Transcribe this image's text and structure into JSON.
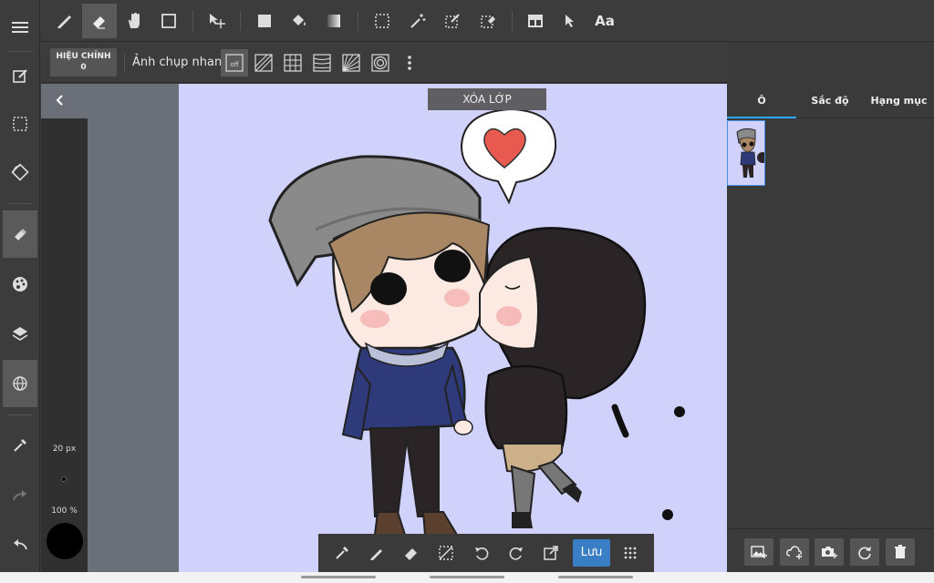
{
  "sub_toolbar": {
    "correction_line1": "HIỆU CHỈNH",
    "correction_line2": "0",
    "snapshot_label": "Ảnh chụp nhanh",
    "snapshot_off": "off"
  },
  "top_toolbar": {
    "text_tool": "Aa"
  },
  "canvas": {
    "clear_layer_label": "XÓA LỚP",
    "background_color": "#d1d2fb"
  },
  "brush_panel": {
    "size_label": "20 px",
    "opacity_label": "100 %",
    "color": "#000000"
  },
  "float_toolbar": {
    "save_label": "Lưu"
  },
  "right_panel": {
    "tabs": [
      {
        "label": "Ô"
      },
      {
        "label": "Sắc độ"
      },
      {
        "label": "Hạng mục"
      }
    ]
  },
  "colors": {
    "accent": "#2da8ff",
    "save_button": "#3a7fc6"
  }
}
